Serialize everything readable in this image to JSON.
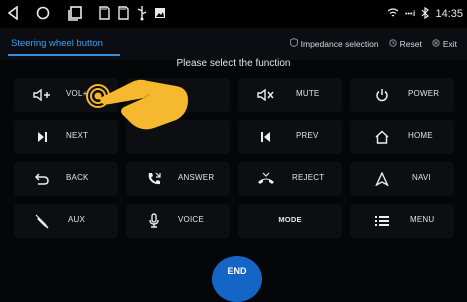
{
  "status": {
    "time": "14:35",
    "signal": "•••il"
  },
  "header": {
    "tab_label": "Steering wheel button",
    "impedance_label": "Impedance selection",
    "reset_label": "Reset",
    "exit_label": "Exit"
  },
  "prompt": "Please select the function",
  "functions": {
    "vol_plus": "VOL+",
    "mute": "MUTE",
    "power": "POWER",
    "next": "NEXT",
    "prev": "PREV",
    "home": "HOME",
    "back": "BACK",
    "answer": "ANSWER",
    "reject": "REJECT",
    "navi": "NAVI",
    "aux": "AUX",
    "voice": "VOICE",
    "mode": "MODE",
    "menu": "MENU"
  },
  "end_label": "END",
  "colors": {
    "accent": "#3aa3f5",
    "end_button": "#1565c6",
    "pointer": "#f5b82e"
  }
}
